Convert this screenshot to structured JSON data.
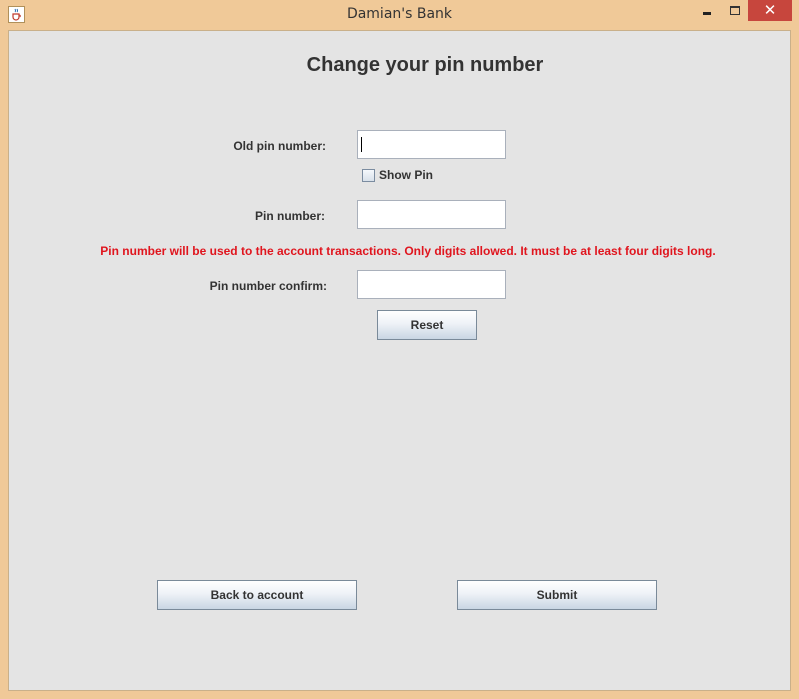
{
  "window": {
    "title": "Damian's Bank",
    "close_glyph": "✕",
    "app_icon": "java-cup-icon",
    "colors": {
      "frame": "#f0c998",
      "close": "#c7463d",
      "content": "#e4e4e4",
      "hint": "#e0151e"
    }
  },
  "form": {
    "heading": "Change your pin number",
    "old_pin_label": "Old pin number:",
    "old_pin_value": "",
    "show_pin_label": "Show Pin",
    "show_pin_checked": false,
    "pin_label": "Pin number:",
    "pin_value": "",
    "hint": "Pin number will be used to the account transactions. Only digits allowed. It must be at least four digits long.",
    "confirm_label": "Pin number confirm:",
    "confirm_value": "",
    "reset_label": "Reset"
  },
  "footer": {
    "back_label": "Back to account",
    "submit_label": "Submit"
  }
}
